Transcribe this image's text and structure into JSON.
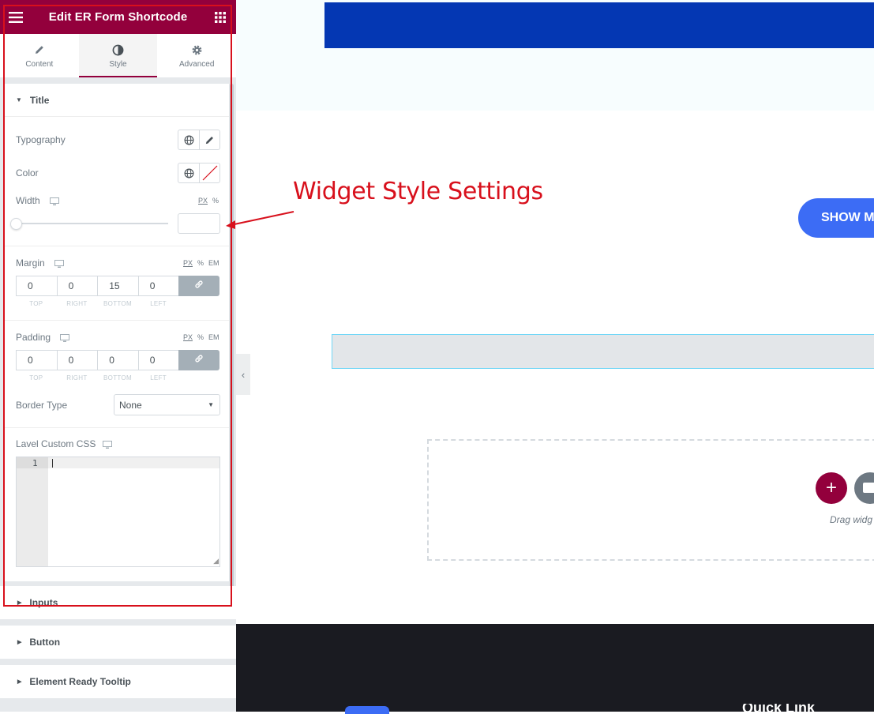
{
  "panel": {
    "title": "Edit ER Form Shortcode",
    "tabs": [
      {
        "label": "Content",
        "icon": "pencil-icon"
      },
      {
        "label": "Style",
        "icon": "contrast-icon"
      },
      {
        "label": "Advanced",
        "icon": "gear-icon"
      }
    ],
    "section_title": "Title",
    "typography_label": "Typography",
    "color_label": "Color",
    "width_label": "Width",
    "width_units": [
      "PX",
      "%"
    ],
    "margin_label": "Margin",
    "margin_units": [
      "PX",
      "%",
      "EM"
    ],
    "margin_values": {
      "top": "0",
      "right": "0",
      "bottom": "15",
      "left": "0"
    },
    "padding_label": "Padding",
    "padding_units": [
      "PX",
      "%",
      "EM"
    ],
    "padding_values": {
      "top": "0",
      "right": "0",
      "bottom": "0",
      "left": "0"
    },
    "dim_labels": {
      "top": "TOP",
      "right": "RIGHT",
      "bottom": "BOTTOM",
      "left": "LEFT"
    },
    "border_type_label": "Border Type",
    "border_type_value": "None",
    "custom_css_label": "Lavel Custom CSS",
    "code_line_number": "1",
    "lower_sections": [
      "Inputs",
      "Button",
      "Element Ready Tooltip"
    ]
  },
  "annotation": {
    "text": "Widget Style Settings",
    "color": "#d8101c"
  },
  "canvas": {
    "show_more_button": "SHOW M",
    "drag_hint": "Drag widg",
    "footer_partial_text": "Quick Link"
  },
  "colors": {
    "accent": "#93003c",
    "blue_bar": "#0437b3",
    "button_blue": "#3c6cf5",
    "footer": "#1a1b21"
  }
}
